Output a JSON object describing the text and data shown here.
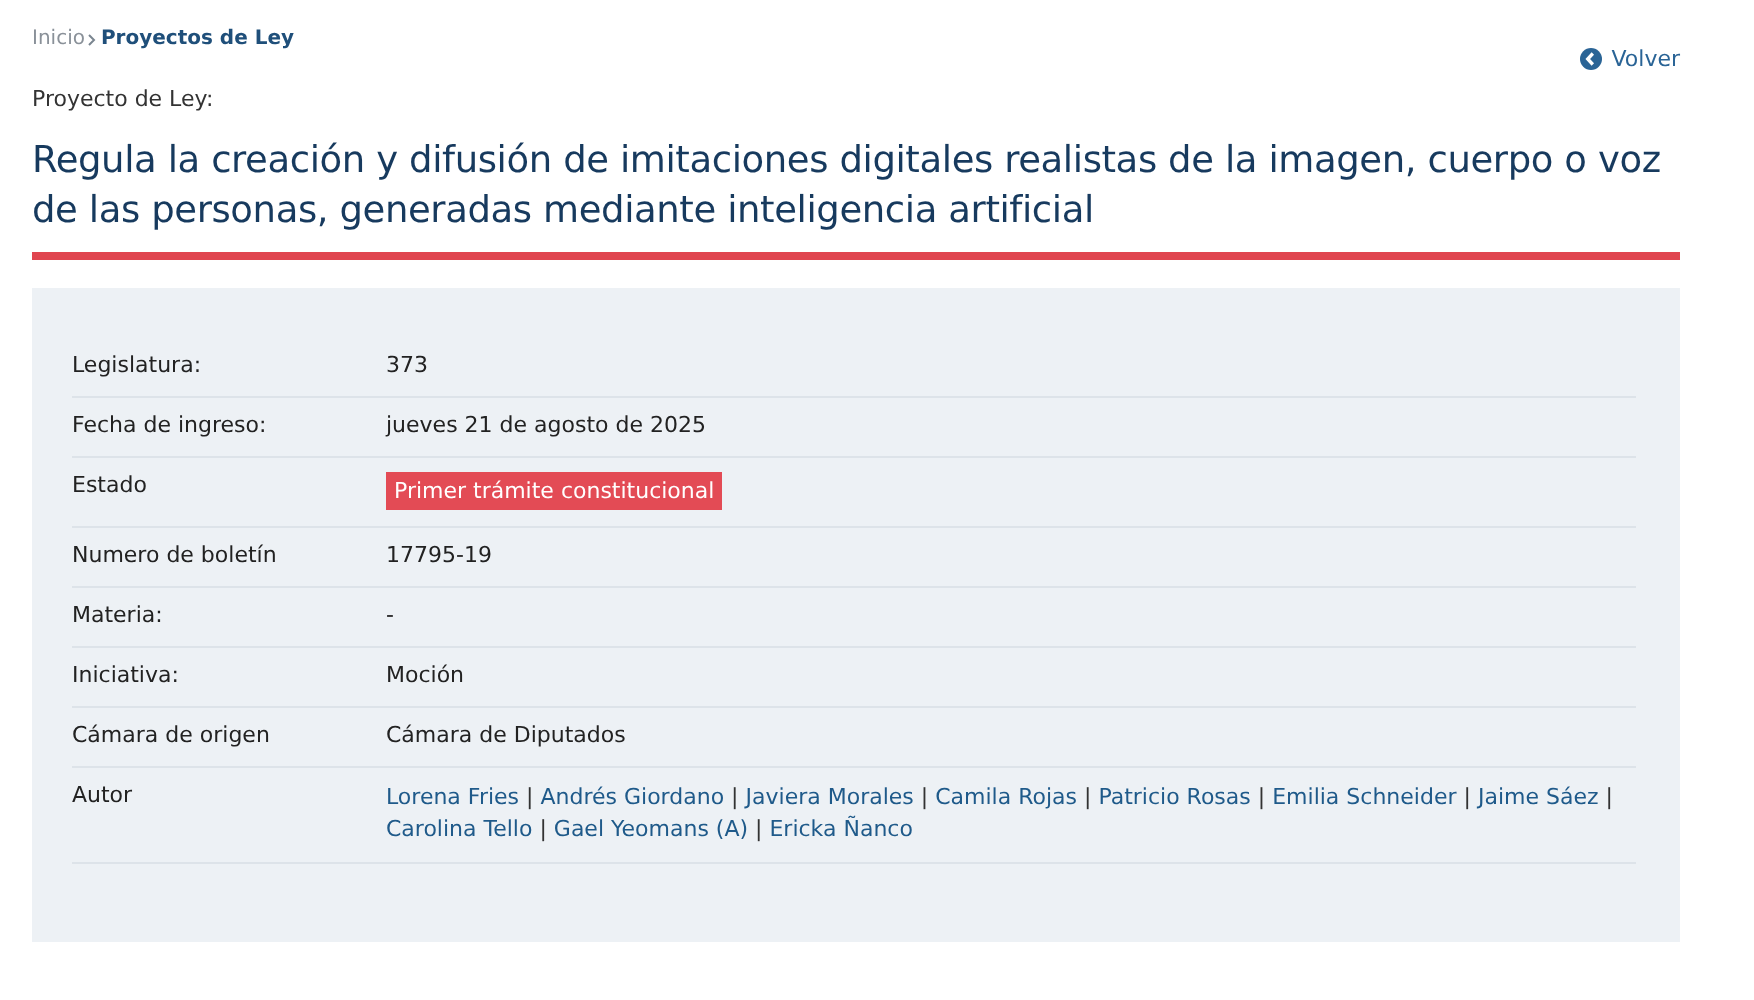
{
  "breadcrumb": [
    {
      "label": "Inicio",
      "current": false
    },
    {
      "label": "Proyectos de Ley",
      "current": true
    }
  ],
  "back_link": "Volver",
  "kicker": "Proyecto de Ley:",
  "title": "Regula la creación y difusión de imitaciones digitales realistas de la imagen, cuerpo o voz de las personas, generadas mediante inteligencia artificial",
  "fields": [
    {
      "label": "Legislatura:",
      "kind": "text",
      "value": "373"
    },
    {
      "label": "Fecha de ingreso:",
      "kind": "text",
      "value": "jueves 21 de agosto de 2025"
    },
    {
      "label": "Estado",
      "kind": "badge",
      "value": "Primer trámite constitucional"
    },
    {
      "label": "Numero de boletín",
      "kind": "text",
      "value": "17795-19"
    },
    {
      "label": "Materia:",
      "kind": "text",
      "value": "-"
    },
    {
      "label": "Iniciativa:",
      "kind": "text",
      "value": "Moción"
    },
    {
      "label": "Cámara de origen",
      "kind": "text",
      "value": "Cámara de Diputados"
    },
    {
      "label": "Autor",
      "kind": "links",
      "separator": "|",
      "links": [
        "Lorena Fries",
        "Andrés Giordano",
        "Javiera Morales",
        "Camila Rojas",
        "Patricio Rosas",
        "Emilia Schneider",
        "Jaime Sáez",
        "Carolina Tello",
        "Gael Yeomans (A)",
        "Ericka Ñanco"
      ]
    }
  ]
}
